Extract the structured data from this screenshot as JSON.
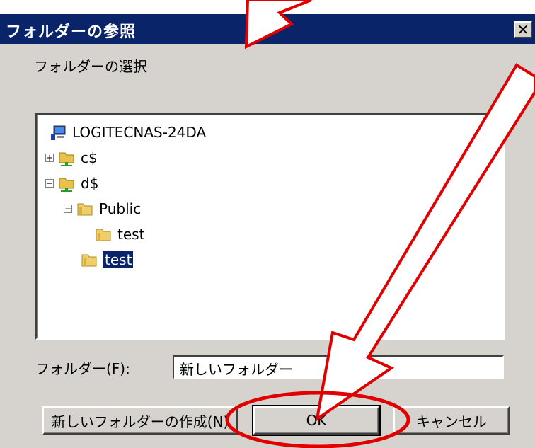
{
  "dialog": {
    "title": "フォルダーの参照",
    "close_glyph": "✕",
    "select_label": "フォルダーの選択"
  },
  "tree": {
    "root": "LOGITECNAS-24DA",
    "c_share": "c$",
    "d_share": "d$",
    "public_folder": "Public",
    "public_test": "test",
    "selected_test": "test",
    "collapsed_glyph": "+",
    "expanded_glyph": "−"
  },
  "folder_field": {
    "label": "フォルダー(F):",
    "value": "新しいフォルダー"
  },
  "buttons": {
    "new_folder": "新しいフォルダーの作成(N)",
    "ok": "OK",
    "cancel": "キャンセル"
  },
  "colors": {
    "titlebar": "#0a246a",
    "dialog_bg": "#d6d3ce",
    "annotation": "#e00000"
  },
  "icons": [
    "computer-icon",
    "network-share-icon",
    "folder-icon",
    "close-icon",
    "arrow-annotation",
    "ellipse-annotation"
  ]
}
